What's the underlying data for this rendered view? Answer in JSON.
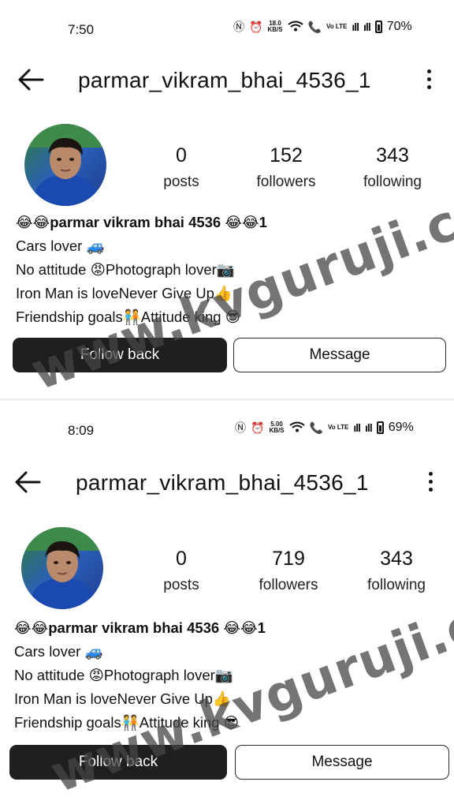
{
  "screens": [
    {
      "status": {
        "time": "7:50",
        "speed_value": "18.0",
        "speed_unit": "KB/S",
        "volte": "Vo LTE",
        "battery": "70%"
      },
      "profile": {
        "username": "parmar_vikram_bhai_4536_1",
        "posts": {
          "count": "0",
          "label": "posts"
        },
        "followers": {
          "count": "152",
          "label": "followers"
        },
        "following": {
          "count": "343",
          "label": "following"
        },
        "bio": [
          "😂😂parmar vikram bhai 4536 😂😂1",
          "Cars lover 🚙",
          "No attitude 😡Photograph lover📷",
          "Iron Man is loveNever Give Up👍",
          "Friendship goals🧑‍🤝‍🧑Attitude king 😎"
        ],
        "follow_back": "Follow back",
        "message": "Message"
      },
      "watermark": "www.kvguruji.com"
    },
    {
      "status": {
        "time": "8:09",
        "speed_value": "5.00",
        "speed_unit": "KB/S",
        "volte": "Vo LTE",
        "battery": "69%"
      },
      "profile": {
        "username": "parmar_vikram_bhai_4536_1",
        "posts": {
          "count": "0",
          "label": "posts"
        },
        "followers": {
          "count": "719",
          "label": "followers"
        },
        "following": {
          "count": "343",
          "label": "following"
        },
        "bio": [
          "😂😂parmar vikram bhai 4536 😂😂1",
          "Cars lover 🚙",
          "No attitude 😡Photograph lover📷",
          "Iron Man is loveNever Give Up👍",
          "Friendship goals🧑‍🤝‍🧑Attitude king 😎"
        ],
        "follow_back": "Follow back",
        "message": "Message"
      },
      "watermark": "www.kvguruji.com"
    }
  ]
}
